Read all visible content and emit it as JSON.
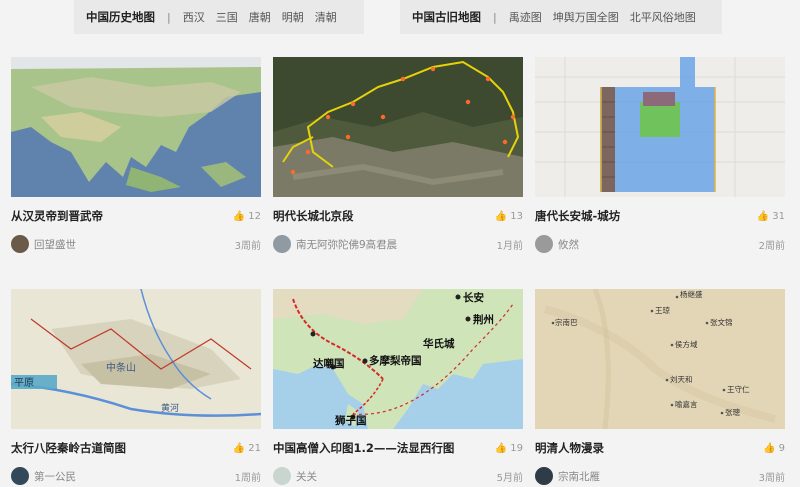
{
  "nav": {
    "history": {
      "title": "中国历史地图",
      "links": [
        "西汉",
        "三国",
        "唐朝",
        "明朝",
        "清朝"
      ]
    },
    "ancient": {
      "title": "中国古旧地图",
      "links": [
        "禹迹图",
        "坤舆万国全图",
        "北平风俗地图"
      ]
    }
  },
  "cards": [
    {
      "title": "从汉灵帝到晋武帝",
      "likes": "12",
      "author": "回望盛世",
      "time": "3周前"
    },
    {
      "title": "明代长城北京段",
      "likes": "13",
      "author": "南无阿弥陀佛9高君晨",
      "time": "1月前"
    },
    {
      "title": "唐代长安城-城坊",
      "likes": "31",
      "author": "攸然",
      "time": "2周前"
    },
    {
      "title": "太行八陉秦岭古道简图",
      "likes": "21",
      "author": "第一公民",
      "time": "1周前"
    },
    {
      "title": "中国高僧入印图1.2——法显西行图",
      "likes": "19",
      "author": "关关",
      "time": "5月前"
    },
    {
      "title": "明清人物漫录",
      "likes": "9",
      "author": "宗南北雁",
      "time": "3周前"
    }
  ],
  "map_labels": {
    "card4": [
      "平原",
      "中条山",
      "黄河"
    ],
    "card5": [
      "长安",
      "荆州",
      "达嚫国",
      "多摩梨帝国",
      "狮子国",
      "华氏城"
    ],
    "card6": [
      "杨继盛",
      "王琼",
      "张文锦",
      "宗南巴",
      "侯方域",
      "刘天和",
      "王守仁",
      "喻嘉言",
      "张璁"
    ]
  },
  "colors": {
    "accent": "#333333",
    "background": "#f3f3f3",
    "nav_bg": "#e9e9e9"
  }
}
